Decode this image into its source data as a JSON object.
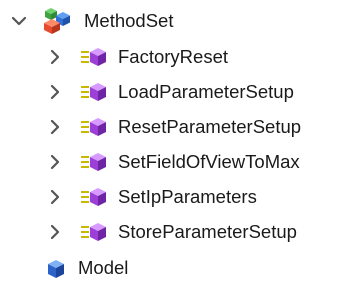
{
  "tree": {
    "root": {
      "label": "MethodSet",
      "icon": "cubes-set-icon",
      "expanded": true
    },
    "methods": [
      {
        "label": "FactoryReset",
        "icon": "method-cube-icon"
      },
      {
        "label": "LoadParameterSetup",
        "icon": "method-cube-icon"
      },
      {
        "label": "ResetParameterSetup",
        "icon": "method-cube-icon"
      },
      {
        "label": "SetFieldOfViewToMax",
        "icon": "method-cube-icon"
      },
      {
        "label": "SetIpParameters",
        "icon": "method-cube-icon"
      },
      {
        "label": "StoreParameterSetup",
        "icon": "method-cube-icon"
      }
    ],
    "model": {
      "label": "Model",
      "icon": "blue-cube-icon"
    }
  },
  "colors": {
    "chevron": "#555555",
    "method_purple": "#9b3fd6",
    "method_lines": "#c9b800",
    "cube_red": "#e64b2f",
    "cube_green": "#47b84a",
    "cube_blue": "#2f6fd6",
    "model_blue": "#2b63c9"
  }
}
